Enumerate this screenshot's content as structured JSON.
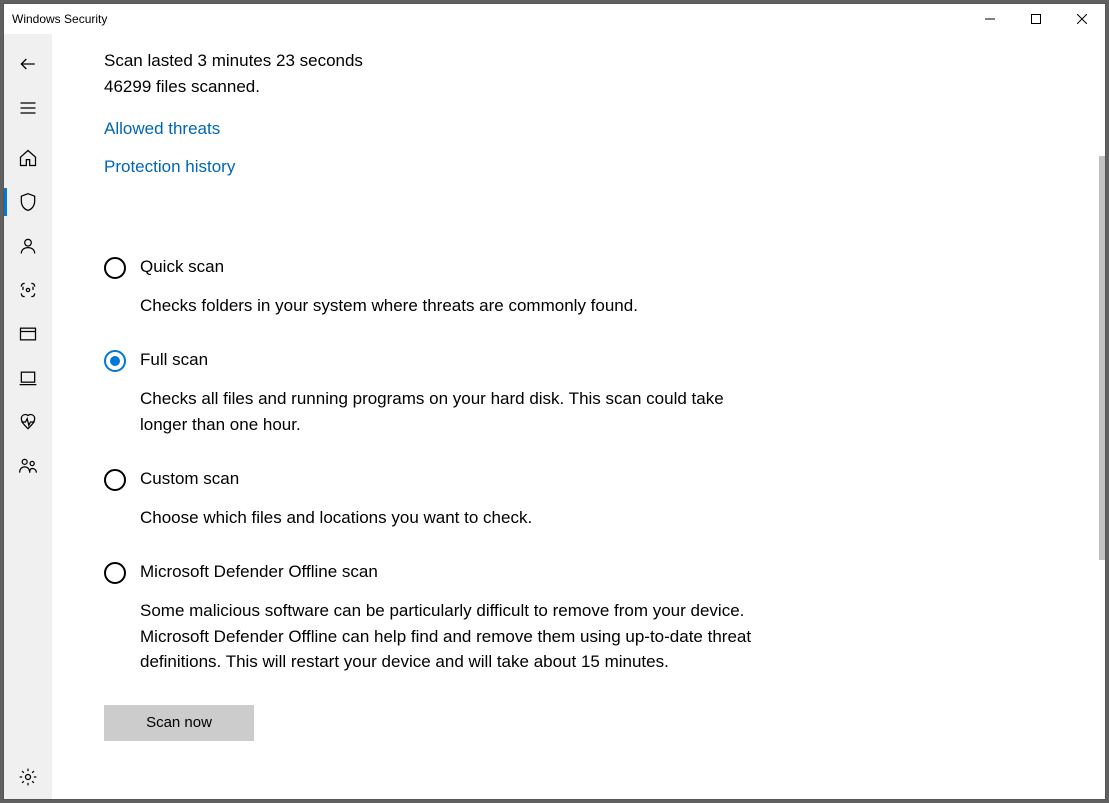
{
  "window": {
    "title": "Windows Security"
  },
  "status": {
    "duration": "Scan lasted 3 minutes 23 seconds",
    "files": "46299 files scanned."
  },
  "links": {
    "allowed": "Allowed threats",
    "history": "Protection history"
  },
  "options": {
    "quick": {
      "title": "Quick scan",
      "desc": "Checks folders in your system where threats are commonly found."
    },
    "full": {
      "title": "Full scan",
      "desc": "Checks all files and running programs on your hard disk. This scan could take longer than one hour."
    },
    "custom": {
      "title": "Custom scan",
      "desc": "Choose which files and locations you want to check."
    },
    "offline": {
      "title": "Microsoft Defender Offline scan",
      "desc": "Some malicious software can be particularly difficult to remove from your device. Microsoft Defender Offline can help find and remove them using up-to-date threat definitions. This will restart your device and will take about 15 minutes."
    }
  },
  "buttons": {
    "scan": "Scan now"
  }
}
